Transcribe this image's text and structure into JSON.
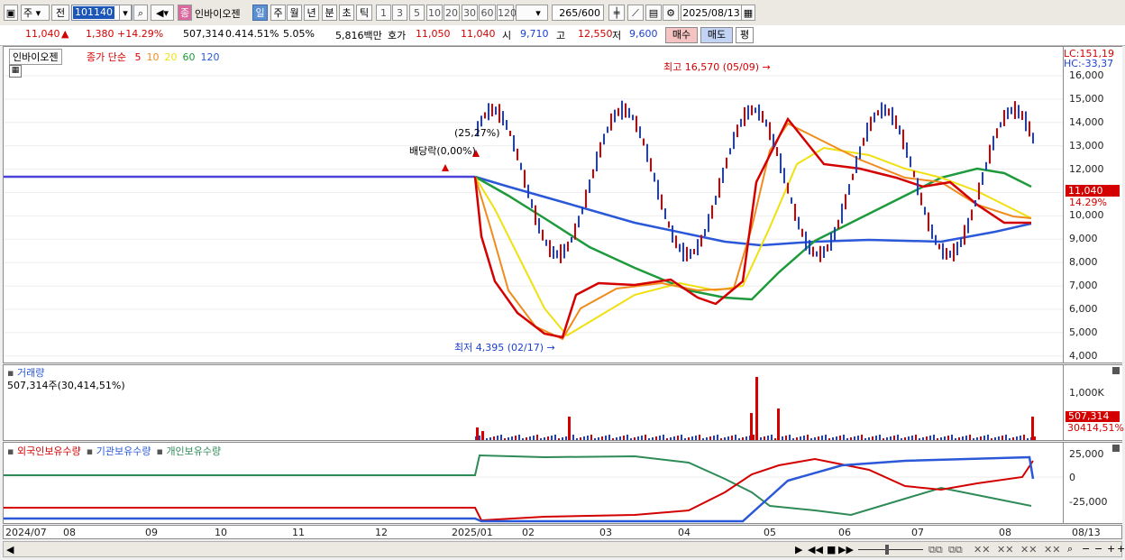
{
  "toolbar": {
    "type_label": "주",
    "prev_label": "전",
    "stock_code": "101140",
    "stock_badge": "종",
    "stock_name": "인바이오젠",
    "periods": [
      "일",
      "주",
      "월",
      "년",
      "분",
      "초",
      "틱"
    ],
    "selected_period": "일",
    "intervals": [
      "1",
      "3",
      "5",
      "10",
      "20",
      "30",
      "60",
      "120"
    ],
    "count_value": "265",
    "count_max": "/600",
    "date": "2025/08/13"
  },
  "price_bar": {
    "price": "11,040",
    "change": "1,380",
    "change_pct": "+14.29%",
    "volume": "507,314",
    "volume_ratio": "0.414.51%",
    "turnover_pct": "5.05%",
    "amount": "5,816백만",
    "ask_label": "호가",
    "ask": "11,050",
    "bid": "11,040",
    "open_label": "시",
    "open": "9,710",
    "high_label": "고",
    "high": "12,550",
    "low_label": "저",
    "low": "9,600",
    "buy_label": "매수",
    "sell_label": "매도",
    "eval_label": "평"
  },
  "price_panel": {
    "stock_tab": "인바이오젠",
    "legend_title": "종가 단순",
    "ma_labels": [
      "5",
      "10",
      "20",
      "60",
      "120"
    ],
    "ma_colors": [
      "#d40000",
      "#f08c1e",
      "#f0e010",
      "#1e9a3c",
      "#2a58d8"
    ],
    "lc": "LC:151,19",
    "hc": "HC:-33,37",
    "current_tag": "11,040",
    "current_pct": "14.29%",
    "y_ticks": [
      "16,000",
      "15,000",
      "14,000",
      "13,000",
      "12,000",
      "11,000",
      "10,000",
      "9,000",
      "8,000",
      "7,000",
      "6,000",
      "5,000",
      "4,000"
    ],
    "ann_high": "최고 16,570 (05/09)",
    "ann_low": "최저 4,395 (02/17)",
    "ann_div": "배당락(0,00%)",
    "ann_pct": "(25,27%)"
  },
  "volume_panel": {
    "title": "거래량",
    "value_text": "507,314주(30,414,51%)",
    "y_tick": "1,000K",
    "tag_value": "507,314",
    "tag_pct": "30414,51%"
  },
  "holder_panel": {
    "legend": [
      "외국인보유수량",
      "기관보유수량",
      "개인보유수량"
    ],
    "legend_colors": [
      "#d40000",
      "#2a58d8",
      "#2e8b57"
    ],
    "y_ticks": [
      "25,000",
      "0",
      "-25,000"
    ]
  },
  "x_axis": {
    "labels": [
      "2024/07",
      "08",
      "09",
      "10",
      "11",
      "12",
      "2025/01",
      "02",
      "03",
      "04",
      "05",
      "06",
      "07",
      "08"
    ],
    "end_label": "08/13"
  }
}
